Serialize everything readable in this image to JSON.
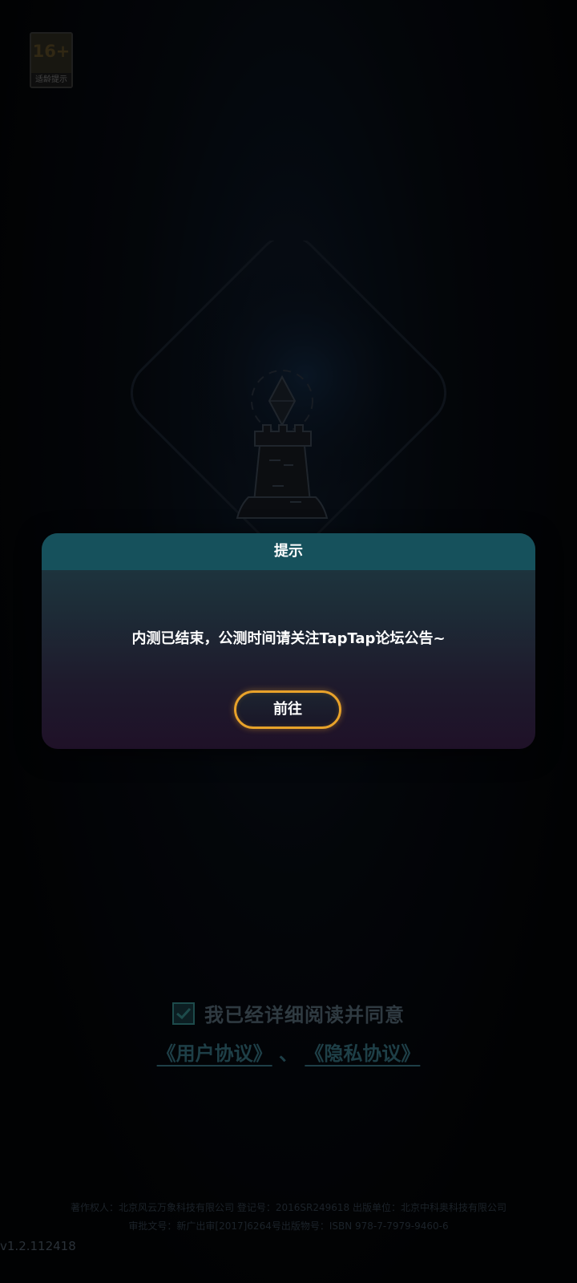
{
  "age_rating": {
    "number": "16+",
    "label": "适龄提示"
  },
  "agreement": {
    "checked": true,
    "text": "我已经详细阅读并同意",
    "user_agreement": "《用户协议》",
    "separator": "、",
    "privacy_policy": "《隐私协议》"
  },
  "footer": {
    "line1": "著作权人：北京风云万象科技有限公司  登记号：2016SR249618  出版单位：北京中科奥科技有限公司",
    "line2": "审批文号：新广出审[2017]6264号出版物号：ISBN 978-7-7979-9460-6",
    "version": "v1.2.112418"
  },
  "dialog": {
    "title": "提示",
    "message": "内测已结束，公测时间请关注TapTap论坛公告~",
    "button_label": "前往"
  },
  "colors": {
    "modal_header": "#16515c",
    "button_border": "#e8a22a",
    "checkbox_mark": "#1d4b4b"
  },
  "icons": {
    "castle": "castle-tower-icon",
    "checkbox": "checkmark-icon"
  }
}
